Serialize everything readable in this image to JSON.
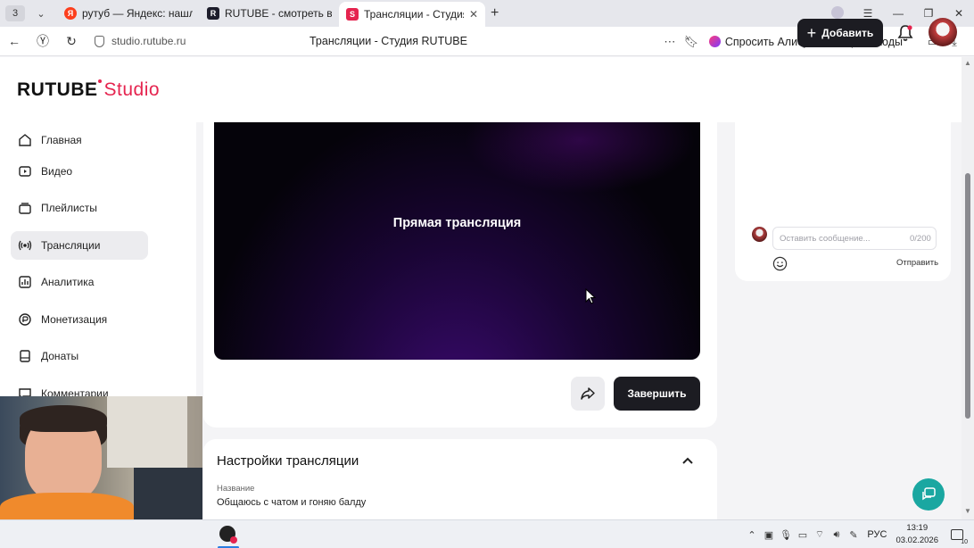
{
  "browser": {
    "tab_counter": "3",
    "tabs": [
      {
        "favicon": "Я",
        "title": "рутуб — Яндекс: нашлось"
      },
      {
        "favicon": "R",
        "title": "RUTUBE - смотреть виде"
      },
      {
        "favicon": "S",
        "title": "Трансляции - Студия R"
      }
    ],
    "url": "studio.rutube.ru",
    "page_title": "Трансляции - Студия RUTUBE",
    "alisa_label": "Спросить Алису AI",
    "promo_label": "Промокоды",
    "promo_icon": "%"
  },
  "header": {
    "logo_main": "RUTUBE",
    "logo_studio": "Studio",
    "add_label": "Добавить"
  },
  "sidebar": {
    "items": [
      {
        "label": "Главная",
        "icon": "home-icon"
      },
      {
        "label": "Видео",
        "icon": "video-icon"
      },
      {
        "label": "Плейлисты",
        "icon": "playlist-icon"
      },
      {
        "label": "Трансляции",
        "icon": "broadcast-icon",
        "active": true
      },
      {
        "label": "Аналитика",
        "icon": "analytics-icon"
      },
      {
        "label": "Монетизация",
        "icon": "monetization-icon"
      },
      {
        "label": "Донаты",
        "icon": "donate-icon"
      },
      {
        "label": "Комментарии",
        "icon": "comments-icon"
      }
    ]
  },
  "player": {
    "label": "Прямая трансляция"
  },
  "actions": {
    "finish_label": "Завершить"
  },
  "chat": {
    "placeholder": "Оставить сообщение...",
    "counter": "0/200",
    "send_label": "Отправить"
  },
  "settings": {
    "title": "Настройки трансляции",
    "name_label": "Название",
    "name_value": "Общаюсь с чатом и гоняю балду"
  },
  "taskbar": {
    "lang": "РУС",
    "time": "13:19",
    "date": "03.02.2026",
    "notif_count": "10"
  },
  "colors": {
    "brand_accent": "#e5244f",
    "dark_button": "#1c1c22",
    "support_fab": "#1aa7a1"
  }
}
